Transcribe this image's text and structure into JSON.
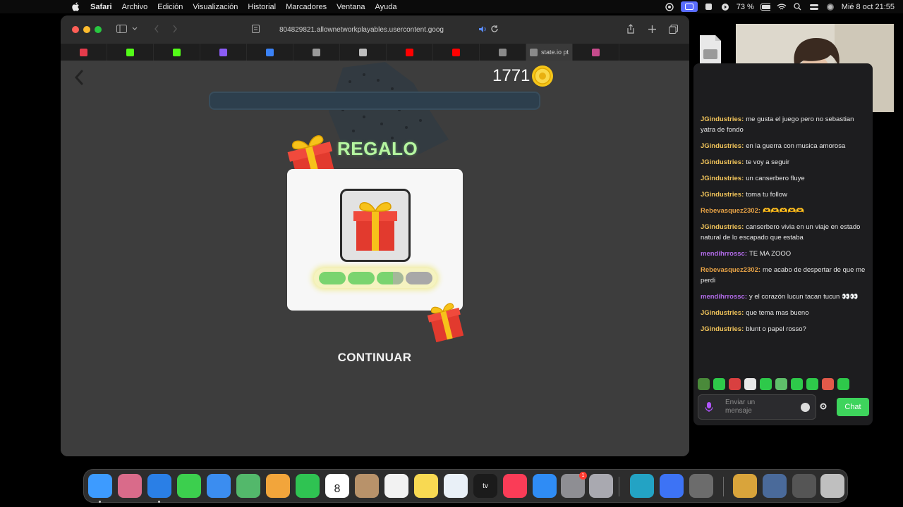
{
  "menubar": {
    "app_name": "Safari",
    "items": [
      "Archivo",
      "Edición",
      "Visualización",
      "Historial",
      "Marcadores",
      "Ventana",
      "Ayuda"
    ],
    "battery_text": "73 %",
    "clock": "Mié 8 oct 21:55"
  },
  "browser": {
    "url": "804829821.allownetworkplayables.usercontent.goog",
    "active_tab_label": "state.io pt",
    "tabs": [
      {
        "icon": "red-cross-favicon",
        "color": "#e53b4b"
      },
      {
        "icon": "kick-favicon",
        "color": "#53fc18"
      },
      {
        "icon": "kick-favicon",
        "color": "#53fc18"
      },
      {
        "icon": "purple-favicon",
        "color": "#8b5cf6"
      },
      {
        "icon": "blue-favicon",
        "color": "#3b82f6"
      },
      {
        "icon": "doc-favicon",
        "color": "#9a9a9a"
      },
      {
        "icon": "tiktok-favicon",
        "color": "#bdbdbd"
      },
      {
        "icon": "youtube-favicon",
        "color": "#ff0000"
      },
      {
        "icon": "youtube-favicon",
        "color": "#ff0000"
      },
      {
        "icon": "grey-favicon",
        "color": "#8a8a8a"
      },
      {
        "icon": "pink-favicon",
        "color": "#c64b8c"
      }
    ]
  },
  "game": {
    "coin_count": "1771",
    "reward_title": "REGALO",
    "progress_segments": [
      "full",
      "full",
      "half",
      "empty"
    ],
    "continue_label": "CONTINUAR",
    "colors": {
      "title": "#b5f5a0",
      "gift_red": "#e23a2e",
      "ribbon": "#f7c21a",
      "segment_fill": "#7ad46f"
    }
  },
  "chat": {
    "messages": [
      {
        "user": "JGindustries",
        "color": "#f0c35a",
        "text": "me gusta el juego pero no sebastian yatra de fondo"
      },
      {
        "user": "JGindustries",
        "color": "#f0c35a",
        "text": "en la guerra con musica amorosa"
      },
      {
        "user": "JGindustries",
        "color": "#f0c35a",
        "text": "te voy a seguir"
      },
      {
        "user": "JGindustries",
        "color": "#f0c35a",
        "text": "un canserbero fluye"
      },
      {
        "user": "JGindustries",
        "color": "#f0c35a",
        "text": "toma tu follow"
      },
      {
        "user": "Rebevasquez2302",
        "color": "#e8a346",
        "text": "🫶🫶🫶🫶🫶"
      },
      {
        "user": "JGindustries",
        "color": "#f0c35a",
        "text": "canserbero vivia en un viaje en estado natural de lo escapado que estaba"
      },
      {
        "user": "mendihrrossc",
        "color": "#b06ae6",
        "text": "TE MA ZOOO"
      },
      {
        "user": "Rebevasquez2302",
        "color": "#e8a346",
        "text": "me acabo de despertar de que me perdi"
      },
      {
        "user": "mendihrrossc",
        "color": "#b06ae6",
        "text": "y el corazón lucun tacan tucun 👀👀"
      },
      {
        "user": "JGindustries",
        "color": "#f0c35a",
        "text": "que tema mas bueno"
      },
      {
        "user": "JGindustries",
        "color": "#f0c35a",
        "text": "blunt o papel rosso?"
      }
    ],
    "input_placeholder": "Enviar un mensaje",
    "send_label": "Chat"
  },
  "dock": {
    "apps": [
      {
        "name": "finder-icon",
        "color": "#3d9bff"
      },
      {
        "name": "launchpad-icon",
        "color": "#d96b8a"
      },
      {
        "name": "safari-icon",
        "color": "#2a7fe6"
      },
      {
        "name": "messages-icon",
        "color": "#3ccf4e"
      },
      {
        "name": "mail-icon",
        "color": "#3b8df0"
      },
      {
        "name": "maps-icon",
        "color": "#53b86b"
      },
      {
        "name": "photos-icon",
        "color": "#f2a53b"
      },
      {
        "name": "facetime-icon",
        "color": "#2fc352"
      },
      {
        "name": "calendar-icon",
        "color": "#ffffff"
      },
      {
        "name": "contacts-icon",
        "color": "#b8926a"
      },
      {
        "name": "reminders-icon",
        "color": "#f2f2f2"
      },
      {
        "name": "notes-icon",
        "color": "#f8d952"
      },
      {
        "name": "freeform-icon",
        "color": "#e9f0f7"
      },
      {
        "name": "tv-icon",
        "color": "#1b1b1b"
      },
      {
        "name": "music-icon",
        "color": "#fa3c57"
      },
      {
        "name": "app-store-icon",
        "color": "#2f8cf5"
      },
      {
        "name": "system-settings-icon",
        "color": "#8e8e93"
      },
      {
        "name": "iphone-mirroring-icon",
        "color": "#a9a9b0"
      },
      {
        "name": "spider-app-icon",
        "color": "#23a3c4"
      },
      {
        "name": "roblox-icon",
        "color": "#3d73f5"
      },
      {
        "name": "activity-monitor-icon",
        "color": "#6c6c6c"
      },
      {
        "name": "downloads-folder-icon",
        "color": "#d9a43b"
      },
      {
        "name": "screenshot-stack-icon",
        "color": "#4a6a9a"
      },
      {
        "name": "screenshot-stack-2-icon",
        "color": "#555555"
      },
      {
        "name": "trash-icon",
        "color": "#bfbfbf"
      }
    ],
    "calendar_day": "8",
    "settings_badge": "1"
  }
}
